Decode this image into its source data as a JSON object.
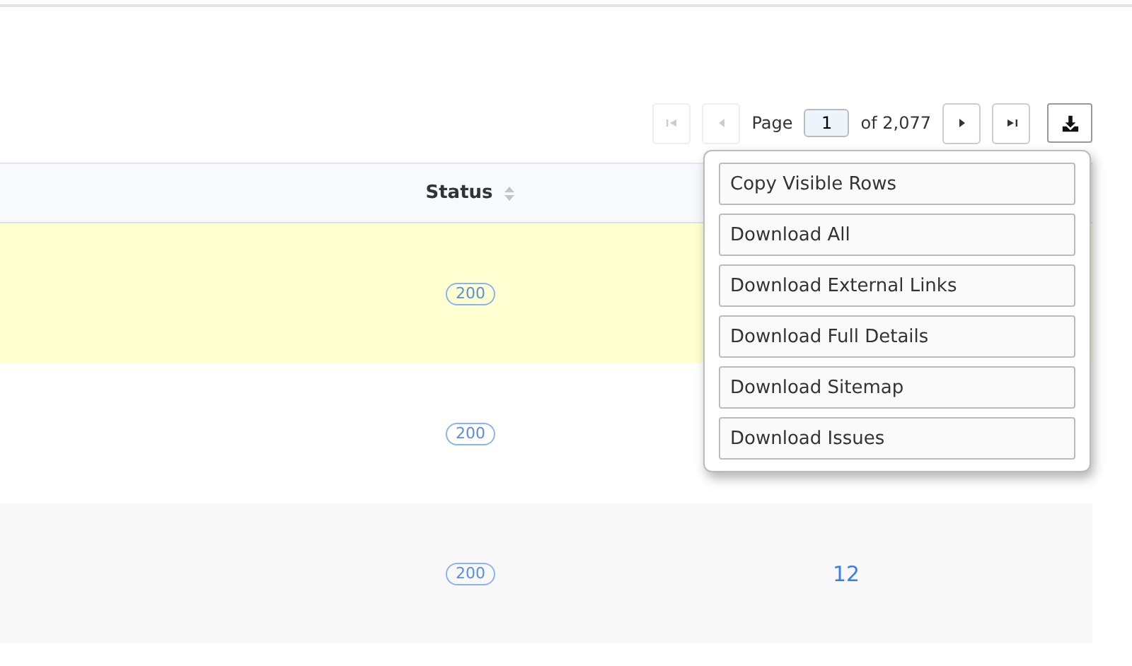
{
  "pager": {
    "first": {
      "disabled": true
    },
    "previous": {
      "disabled": true
    },
    "page_label": "Page",
    "page_value": "1",
    "of_label": "of 2,077",
    "next": {
      "disabled": false
    },
    "last": {
      "disabled": false
    }
  },
  "table": {
    "columns": [
      {
        "label": "Status",
        "sortable": true
      }
    ],
    "rows": [
      {
        "highlighted": true,
        "status": "200"
      },
      {
        "highlighted": false,
        "status": "200"
      },
      {
        "highlighted": false,
        "status": "200",
        "column_2": "12"
      }
    ]
  },
  "download_menu": {
    "open": true,
    "items": [
      "Copy Visible Rows",
      "Download All",
      "Download External Links",
      "Download Full Details",
      "Download Sitemap",
      "Download Issues"
    ]
  }
}
